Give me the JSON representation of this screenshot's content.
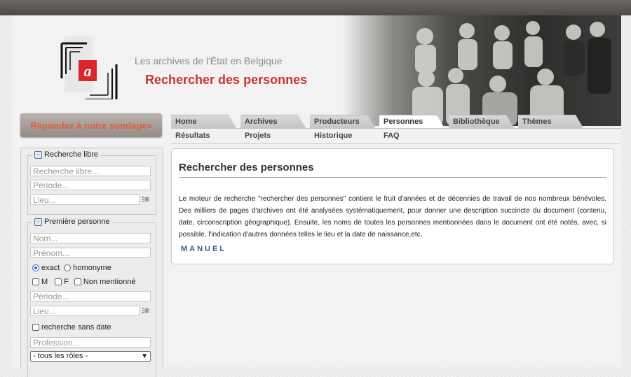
{
  "header": {
    "subtitle": "Les archives de l'État en Belgique",
    "title": "Rechercher des personnes",
    "logo_letter": "a"
  },
  "survey_button": "Répondez à notre sondage»",
  "nav": {
    "tabs": [
      "Home",
      "Archives",
      "Producteurs",
      "Personnes",
      "Bibliothèque",
      "Thèmes"
    ],
    "active_tab": "Personnes",
    "subtabs": [
      "Résultats",
      "Projets",
      "Historique",
      "FAQ"
    ]
  },
  "sidebar": {
    "free_search": {
      "legend": "Recherche libre",
      "placeholders": [
        "Recherche libre...",
        "Période...",
        "Lieu..."
      ]
    },
    "first_person": {
      "legend": "Première personne",
      "nom": "Nom...",
      "prenom": "Prénom...",
      "exact": "exact",
      "homonyme": "homonyme",
      "m": "M",
      "f": "F",
      "non_mentionne": "Non mentionné",
      "periode": "Période...",
      "lieu": "Lieu...",
      "sans_date": "recherche sans date",
      "profession": "Profession...",
      "roles_selected": "- tous les rôles -"
    }
  },
  "main": {
    "heading": "Rechercher des personnes",
    "body": "Le moteur de recherche \"rechercher des personnes\" contient le fruit d'années et de décennies de travail de nos nombreux bénévoles. Des milliers de pages d'archives ont été analysées systématiquement, pour donner une description succincte du document (contenu, date, circonscription géographique). Ensuite, les noms de toutes les personnes mentionnées dans le document ont été notés, avec, si possible, l'indication d'autres données telles le lieu et la date de naissance,etc.",
    "manual_link": "MANUEL"
  },
  "colors": {
    "title_red": "#c8372d",
    "survey_orange": "#e45a3e",
    "link_blue": "#3b5a8c"
  }
}
